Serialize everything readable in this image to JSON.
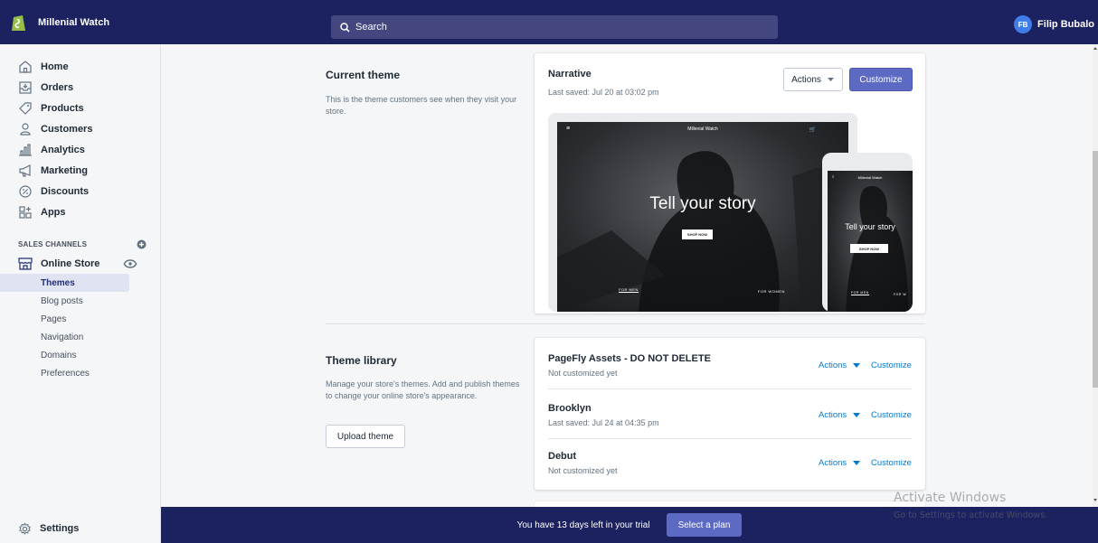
{
  "topbar": {
    "store_name": "Millenial Watch",
    "search_placeholder": "Search",
    "user_initials": "FB",
    "user_name": "Filip Bubalo"
  },
  "sidebar": {
    "items": [
      {
        "label": "Home",
        "icon": "home-icon"
      },
      {
        "label": "Orders",
        "icon": "orders-icon"
      },
      {
        "label": "Products",
        "icon": "tag-icon"
      },
      {
        "label": "Customers",
        "icon": "person-icon"
      },
      {
        "label": "Analytics",
        "icon": "bar-chart-icon"
      },
      {
        "label": "Marketing",
        "icon": "megaphone-icon"
      },
      {
        "label": "Discounts",
        "icon": "discount-icon"
      },
      {
        "label": "Apps",
        "icon": "apps-icon"
      }
    ],
    "sales_channels_label": "SALES CHANNELS",
    "online_store_label": "Online Store",
    "online_store_sub": [
      "Themes",
      "Blog posts",
      "Pages",
      "Navigation",
      "Domains",
      "Preferences"
    ],
    "settings_label": "Settings"
  },
  "current_theme": {
    "heading": "Current theme",
    "description": "This is the theme customers see when they visit your store.",
    "name": "Narrative",
    "saved": "Last saved: Jul 20 at 03:02 pm",
    "actions_label": "Actions",
    "customize_label": "Customize",
    "preview": {
      "store_name": "Millenial Watch",
      "headline": "Tell your story",
      "cta": "SHOP NOW",
      "for_men": "FOR MEN",
      "for_women": "FOR WOMEN",
      "mobile_for_w": "FOR W"
    }
  },
  "theme_library": {
    "heading": "Theme library",
    "description": "Manage your store's themes. Add and publish themes to change your online store's appearance.",
    "upload_label": "Upload theme",
    "themes": [
      {
        "name": "PageFly Assets - DO NOT DELETE",
        "meta": "Not customized yet",
        "actions": "Actions",
        "customize": "Customize"
      },
      {
        "name": "Brooklyn",
        "meta": "Last saved: Jul 24 at 04:35 pm",
        "actions": "Actions",
        "customize": "Customize"
      },
      {
        "name": "Debut",
        "meta": "Not customized yet",
        "actions": "Actions",
        "customize": "Customize"
      }
    ]
  },
  "trial": {
    "text": "You have 13 days left in your trial",
    "button": "Select a plan"
  },
  "watermark": {
    "title": "Activate Windows",
    "subtitle": "Go to Settings to activate Windows."
  },
  "colors": {
    "topbar": "#1c2260",
    "primary": "#5c6ac4",
    "link": "#007ace"
  }
}
